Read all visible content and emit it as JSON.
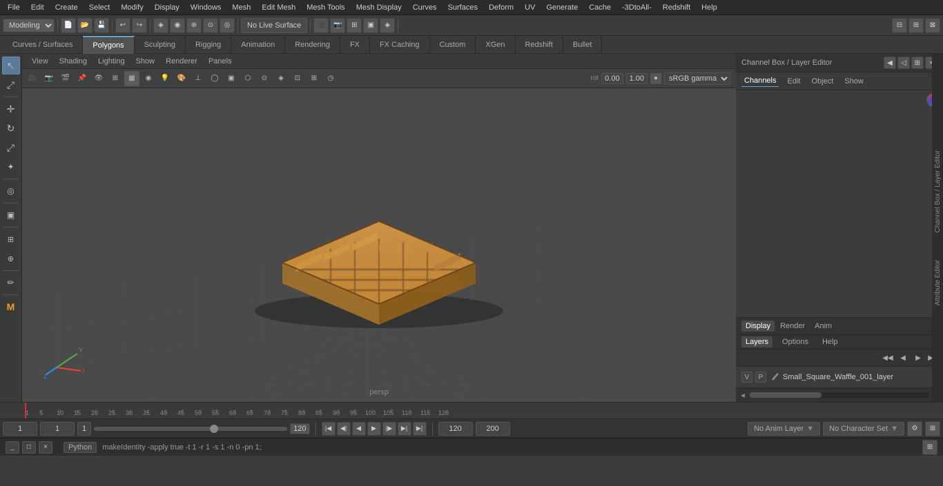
{
  "app": {
    "title": "Maya"
  },
  "menu_bar": {
    "items": [
      "File",
      "Edit",
      "Create",
      "Select",
      "Modify",
      "Display",
      "Windows",
      "Mesh",
      "Edit Mesh",
      "Mesh Tools",
      "Mesh Display",
      "Curves",
      "Surfaces",
      "Deform",
      "UV",
      "Generate",
      "Cache",
      "-3DtoAll-",
      "Redshift",
      "Help"
    ]
  },
  "toolbar1": {
    "mode_label": "Modeling",
    "live_surface_label": "No Live Surface"
  },
  "tabs": {
    "items": [
      "Curves / Surfaces",
      "Polygons",
      "Sculpting",
      "Rigging",
      "Animation",
      "Rendering",
      "FX",
      "FX Caching",
      "Custom",
      "XGen",
      "Redshift",
      "Bullet"
    ],
    "active": "Polygons"
  },
  "viewport_menu": {
    "items": [
      "View",
      "Shading",
      "Lighting",
      "Show",
      "Renderer",
      "Panels"
    ]
  },
  "viewport": {
    "label": "persp",
    "gamma": "sRGB gamma",
    "rot_x": "0.00",
    "rot_y": "1.00"
  },
  "right_panel": {
    "title": "Channel Box / Layer Editor",
    "tabs": [
      "Channels",
      "Edit",
      "Object",
      "Show"
    ]
  },
  "layer_panel": {
    "title": "Layers",
    "tabs": [
      "Display",
      "Render",
      "Anim"
    ],
    "active_tab": "Display",
    "sub_tabs": [
      "Layers",
      "Options",
      "Help"
    ],
    "layer_name": "Small_Square_Waffle_001_layer",
    "v_label": "V",
    "p_label": "P"
  },
  "timeline": {
    "ticks": [
      "1",
      "5",
      "10",
      "15",
      "20",
      "25",
      "30",
      "35",
      "40",
      "45",
      "50",
      "55",
      "60",
      "65",
      "70",
      "75",
      "80",
      "85",
      "90",
      "95",
      "100",
      "105",
      "110",
      "115",
      "12"
    ]
  },
  "bottom_controls": {
    "frame_start": "1",
    "frame_current": "1",
    "frame_tick": "1",
    "frame_end": "120",
    "playback_end": "120",
    "playback_max": "200",
    "anim_layer": "No Anim Layer",
    "char_set": "No Character Set"
  },
  "status_bar": {
    "python_label": "Python",
    "command": "makeIdentity -apply true -t 1 -r 1 -s 1 -n 0 -pn 1;"
  },
  "bottom_window": {
    "title": "",
    "close": "×",
    "minimize": "_"
  },
  "side_labels": [
    "Channel Box / Layer Editor",
    "Attribute Editor"
  ],
  "icons": {
    "arrow": "↖",
    "move": "✛",
    "rotate": "↻",
    "scale": "⤢",
    "universal": "✦",
    "soft": "◎",
    "last": "▣",
    "lasso": "⌇",
    "paint": "✏",
    "chisel": "◈",
    "undo": "↩",
    "redo": "↪",
    "play_back": "◀◀",
    "play_prev": "◀|",
    "step_back": "◀",
    "play": "▶",
    "step_fwd": "▶|",
    "play_fwd": "▶▶",
    "play_end": "|▶▶"
  }
}
